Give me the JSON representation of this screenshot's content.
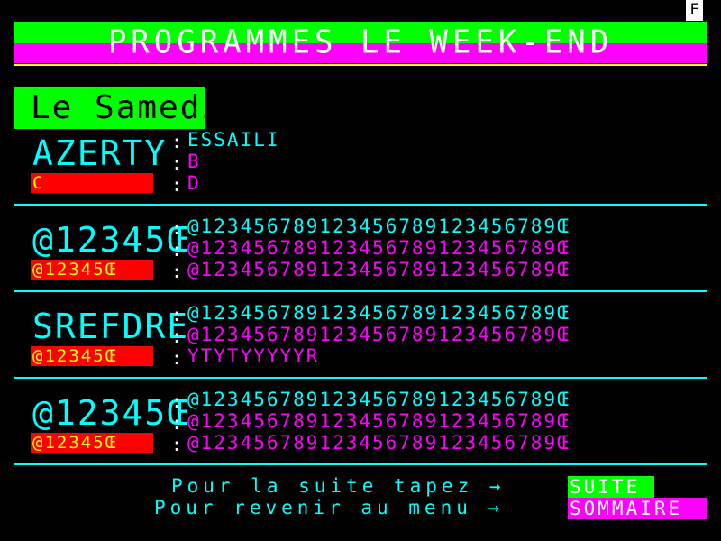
{
  "badge": "F",
  "header": {
    "title": "PROGRAMMES LE WEEK-END"
  },
  "day": {
    "label": "Le Samedi"
  },
  "blocks": [
    {
      "name": "AZERTY",
      "tag": "C",
      "lines": [
        "ESSAILI",
        "B",
        "D"
      ]
    },
    {
      "name": "@12345Œ",
      "tag": "@12345Œ",
      "lines": [
        "@123456789123456789123456789Œ",
        "@123456789123456789123456789Œ",
        "@123456789123456789123456789Œ"
      ]
    },
    {
      "name": "SREFDRE",
      "tag": "@12345Œ",
      "lines": [
        "@123456789123456789123456789Œ",
        "@123456789123456789123456789Œ",
        "YTYTYYYYYR"
      ]
    },
    {
      "name": "@12345Œ",
      "tag": "@12345Œ",
      "lines": [
        "@123456789123456789123456789Œ",
        "@123456789123456789123456789Œ",
        "@123456789123456789123456789Œ"
      ]
    }
  ],
  "footer": {
    "line1": "Pour la suite tapez →",
    "line2": "Pour revenir au menu →",
    "suite_label": "SUITE",
    "sommaire_label": "SOMMAIRE"
  },
  "colors": {
    "green": "#00ff00",
    "magenta": "#ff00ff",
    "cyan": "#00ffff",
    "red": "#ff0000",
    "yellow": "#ffff00"
  }
}
